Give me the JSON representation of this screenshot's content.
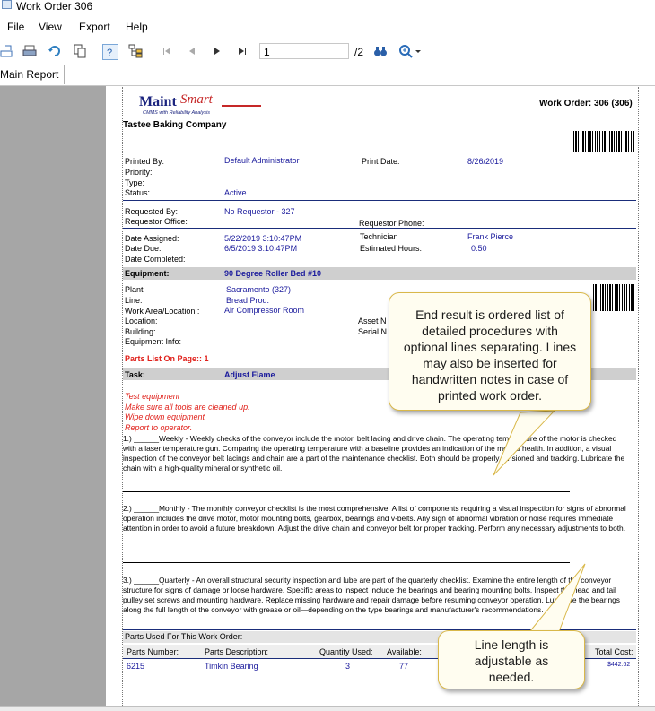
{
  "window": {
    "title": "Work Order 306"
  },
  "menu": [
    "File",
    "View",
    "Export",
    "Help"
  ],
  "toolbar": {
    "page_input": "1",
    "page_total": "/2",
    "icons": [
      "export-icon",
      "print-icon",
      "refresh-icon",
      "copy-icon",
      "help-icon",
      "tree-icon",
      "first-page-icon",
      "prev-page-icon",
      "next-page-icon",
      "last-page-icon",
      "binoculars-icon",
      "zoom-icon"
    ]
  },
  "tabs": [
    "Main Report"
  ],
  "report": {
    "logo": {
      "brand_a": "Maint",
      "brand_b": "Smart",
      "tagline": "CMMS with Reliability Analysis"
    },
    "header": {
      "work_order": "Work Order: 306 (306)",
      "company": "Tastee Baking Company"
    },
    "printed_by_label": "Printed By:",
    "printed_by": "Default Administrator",
    "print_date_label": "Print Date:",
    "print_date": "8/26/2019",
    "priority_label": "Priority:",
    "type_label": "Type:",
    "status_label": "Status:",
    "status": "Active",
    "requested_by_label": "Requested By:",
    "requested_by": "No Requestor - 327",
    "requestor_office_label": "Requestor Office:",
    "requestor_phone_label": "Requestor Phone:",
    "date_assigned_label": "Date Assigned:",
    "date_assigned": "5/22/2019  3:10:47PM",
    "date_due_label": "Date Due:",
    "date_due": "6/5/2019  3:10:47PM",
    "date_completed_label": "Date Completed:",
    "technician_label": "Technician",
    "technician": "Frank Pierce",
    "estimated_hours_label": "Estimated Hours:",
    "estimated_hours": "0.50",
    "equipment_label": "Equipment:",
    "equipment": "90 Degree Roller Bed #10",
    "plant_label": "Plant",
    "plant": "Sacramento (327)",
    "line_label": "Line:",
    "line": "Bread Prod.",
    "work_area_label": "Work Area/Location :",
    "work_area": "Air Compressor Room",
    "location_label": "Location:",
    "building_label": "Building:",
    "equipment_info_label": "Equipment Info:",
    "asset_label": "Asset N",
    "serial_label": "Serial N",
    "parts_list": "Parts List On Page:: 1",
    "task_label": "Task:",
    "task": "Adjust Flame",
    "task_notes": [
      "Test equipment",
      "Make sure all tools are cleaned up.",
      "Wipe down equipment",
      "Report to operator."
    ],
    "procedures": [
      "1.) ______Weekly - Weekly checks of the conveyor include the motor, belt lacing and drive chain. The operating temperature of the motor is checked with a laser temperature gun. Comparing the operating temperature with a baseline provides an indication of the motors health. In addition, a visual inspection of the conveyor belt lacings and chain are a part of the maintenance checklist. Both should be properly tensioned and tracking. Lubricate the chain with a high-quality mineral or synthetic oil.",
      "2.) ______Monthly - The monthly conveyor checklist is the most comprehensive. A list of components requiring a visual inspection for signs of abnormal operation includes the drive motor, motor mounting bolts, gearbox, bearings and v-belts. Any sign of abnormal vibration or noise requires immediate attention in order to avoid a future breakdown. Adjust the drive chain and conveyor belt for proper tracking. Perform any necessary adjustments to both.",
      "3.) ______Quarterly - An overall structural security inspection and lube are part of the quarterly checklist. Examine the entire length of the conveyor structure for signs of damage or loose hardware. Specific areas to inspect include the bearings and bearing mounting bolts. Inspect the head and tail pulley set screws and mounting hardware. Replace missing hardware and repair damage before resuming conveyor operation. Lubricate the bearings along the full length of the conveyor with grease or oil—depending on the type bearings and manufacturer's recommendations."
    ],
    "parts_used_label": "Parts Used For This Work Order:",
    "parts_columns": {
      "number": "Parts Number:",
      "description": "Parts Description:",
      "qty": "Quantity Used:",
      "available": "Available:",
      "total_cost": "Total Cost:"
    },
    "parts_rows": [
      {
        "number": "6215",
        "description": "Timkin Bearing",
        "qty": "3",
        "available": "77",
        "total_cost": "$442.62"
      }
    ]
  },
  "callouts": {
    "top": "End result is ordered list of detailed procedures with optional lines separating. Lines may also be inserted for handwritten notes in case of printed work order.",
    "bottom": "Line length is adjustable as needed."
  }
}
